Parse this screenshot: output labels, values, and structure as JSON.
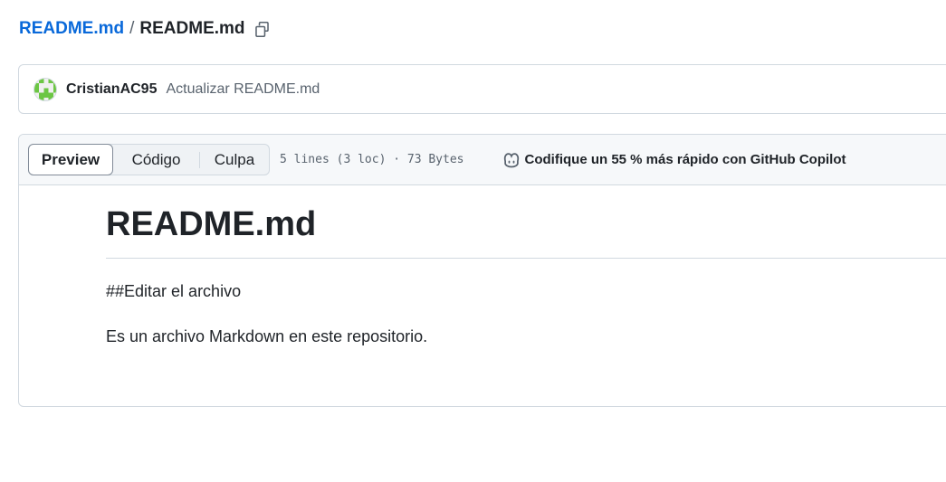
{
  "breadcrumb": {
    "repo": "README.md",
    "separator": "/",
    "file": "README.md"
  },
  "commit": {
    "author": "CristianAC95",
    "message": "Actualizar README.md"
  },
  "file_header": {
    "tabs": [
      {
        "label": "Preview",
        "active": true
      },
      {
        "label": "Código",
        "active": false
      },
      {
        "label": "Culpa",
        "active": false
      }
    ],
    "meta": "5 lines (3 loc) · 73 Bytes",
    "copilot_label": "Codifique un 55 % más rápido con GitHub Copilot"
  },
  "markdown": {
    "heading": "README.md",
    "paragraphs": [
      "##Editar el archivo",
      "Es un archivo Markdown en este repositorio."
    ]
  },
  "colors": {
    "link": "#0969da",
    "text": "#1f2328",
    "muted": "#59636e",
    "border": "#d1d9e0",
    "header_bg": "#f6f8fa"
  }
}
